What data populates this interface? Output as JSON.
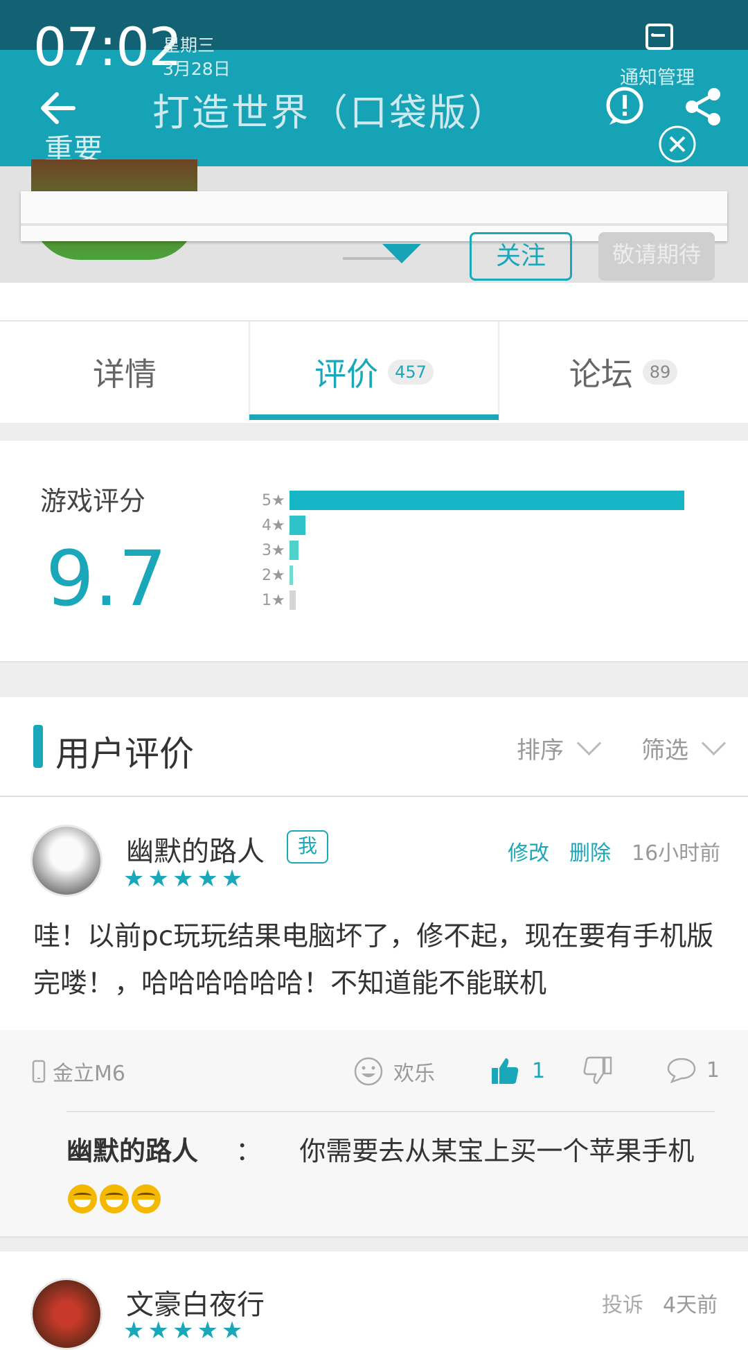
{
  "status_bar": {
    "time": "07:02",
    "weekday": "星期三",
    "date": "3月28日"
  },
  "header": {
    "title": "打造世界（口袋版）",
    "notification_manage": "通知管理",
    "important": "重要",
    "bg_color": "#17a3b6"
  },
  "game_card": {
    "follow_label": "关注",
    "coming_label": "敬请期待"
  },
  "tabs": [
    {
      "label": "详情",
      "badge": ""
    },
    {
      "label": "评价",
      "badge": "457"
    },
    {
      "label": "论坛",
      "badge": "89"
    }
  ],
  "rating": {
    "label": "游戏评分",
    "score": "9.7",
    "distribution": [
      {
        "stars": "5",
        "fraction": 1.0,
        "color": "#16b6c6"
      },
      {
        "stars": "4",
        "fraction": 0.04,
        "color": "#2dc3c8"
      },
      {
        "stars": "3",
        "fraction": 0.022,
        "color": "#4fd2c9"
      },
      {
        "stars": "2",
        "fraction": 0.008,
        "color": "#73dccf"
      },
      {
        "stars": "1",
        "fraction": 0.015,
        "color": "#d6d6d6"
      }
    ]
  },
  "reviews_section": {
    "title": "用户评价",
    "sort_label": "排序",
    "filter_label": "筛选"
  },
  "reviews": [
    {
      "username": "幽默的路人",
      "me_badge": "我",
      "stars": "★★★★★",
      "edit_label": "修改",
      "delete_label": "删除",
      "time": "16小时前",
      "text": "哇！以前pc玩玩结果电脑坏了，修不起，现在要有手机版完喽！，哈哈哈哈哈哈！不知道能不能联机",
      "device": "金立M6",
      "mood": "欢乐",
      "likes": "1",
      "comments": "1",
      "reply": {
        "author": "幽默的路人",
        "separator": "：",
        "text": "你需要去从某宝上买一个苹果手机"
      }
    },
    {
      "username": "文豪白夜行",
      "stars": "★★★★★",
      "report_label": "投诉",
      "time": "4天前"
    }
  ]
}
